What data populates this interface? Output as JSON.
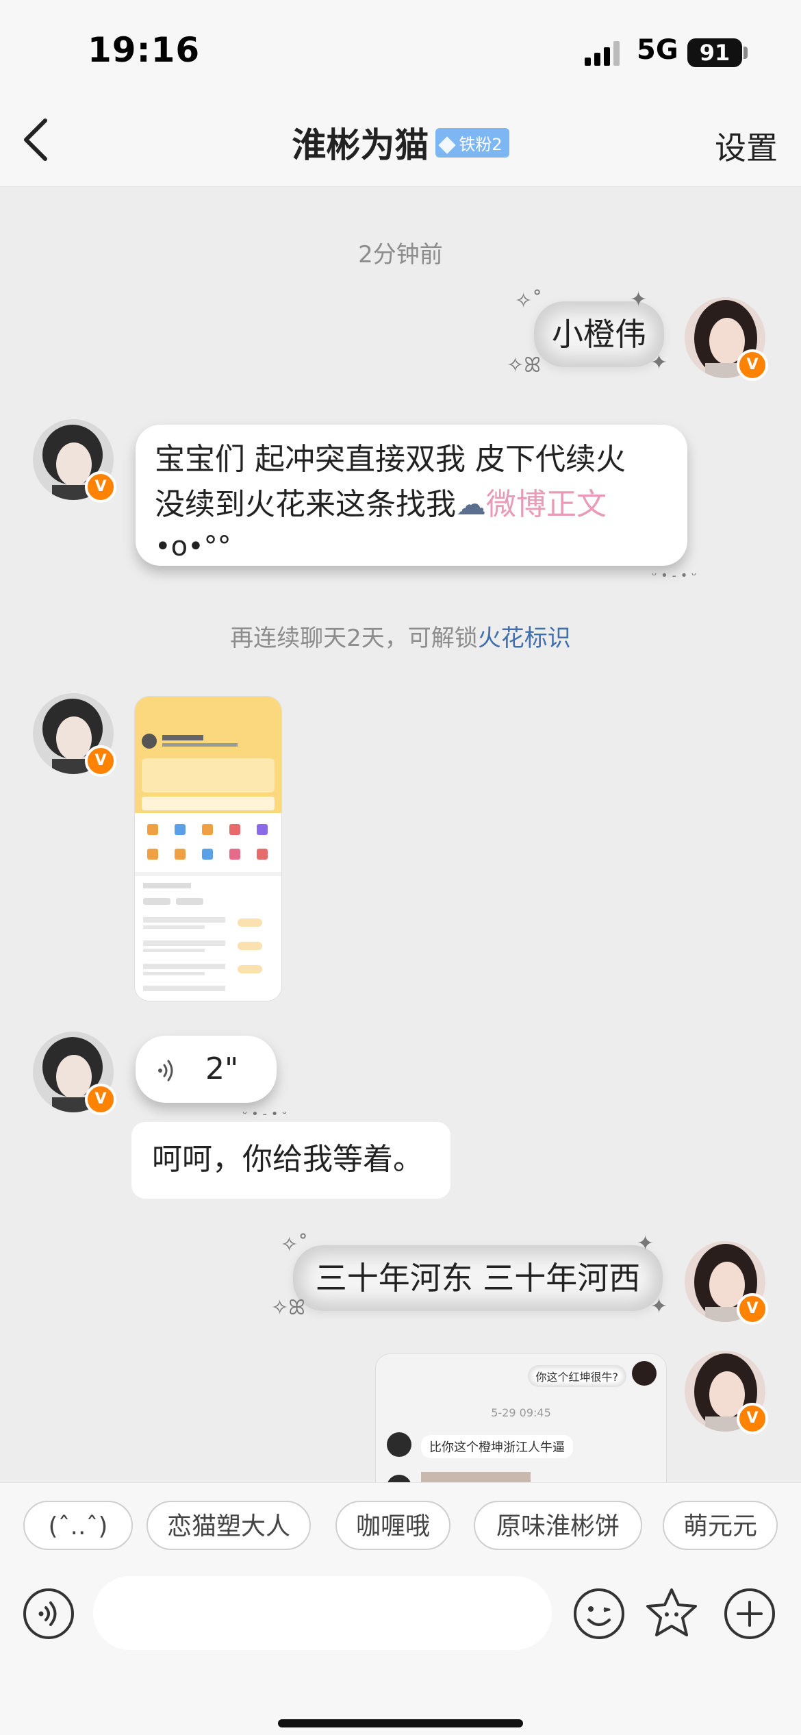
{
  "status_bar": {
    "time": "19:16",
    "network": "5G",
    "battery": "91"
  },
  "header": {
    "back_icon": "chevron-left-icon",
    "title": "淮彬为猫",
    "badge": "铁粉2",
    "settings_label": "设置"
  },
  "chat": {
    "timestamp": "2分钟前",
    "messages": [
      {
        "from": "me",
        "type": "fancy_text",
        "text": "小橙伟"
      },
      {
        "from": "other",
        "type": "card_text",
        "line1": "宝宝们 起冲突直接双我 皮下代续火",
        "line2_prefix": "没续到火花来这条找我",
        "line2_link": "微博正文",
        "line3": "•o•°°"
      },
      {
        "from": "other",
        "type": "image",
        "desc": "screenshot"
      },
      {
        "from": "other",
        "type": "voice",
        "duration": "2\""
      },
      {
        "from": "other",
        "type": "plain_text",
        "text": "呵呵，你给我等着。"
      },
      {
        "from": "me",
        "type": "fancy_text",
        "text": "三十年河东 三十年河西"
      },
      {
        "from": "me",
        "type": "image_preview",
        "quote": "你这个红坤很牛?",
        "time": "5-29 09:45",
        "reply": "比你这个橙坤浙江人牛逼"
      }
    ],
    "hint": {
      "prefix": "再连续聊天2天，可解锁",
      "link": "火花标识"
    },
    "verified_badge": "V"
  },
  "quick_replies": [
    "(ˆ..ˆ)",
    "恋猫塑大人",
    "咖喱哦",
    "原味淮彬饼",
    "萌元元"
  ],
  "input": {
    "placeholder": ""
  },
  "colors": {
    "accent": "#ff8200",
    "link": "#3e6fb1",
    "pink": "#e99ab6",
    "badge": "#7cb7f3"
  }
}
